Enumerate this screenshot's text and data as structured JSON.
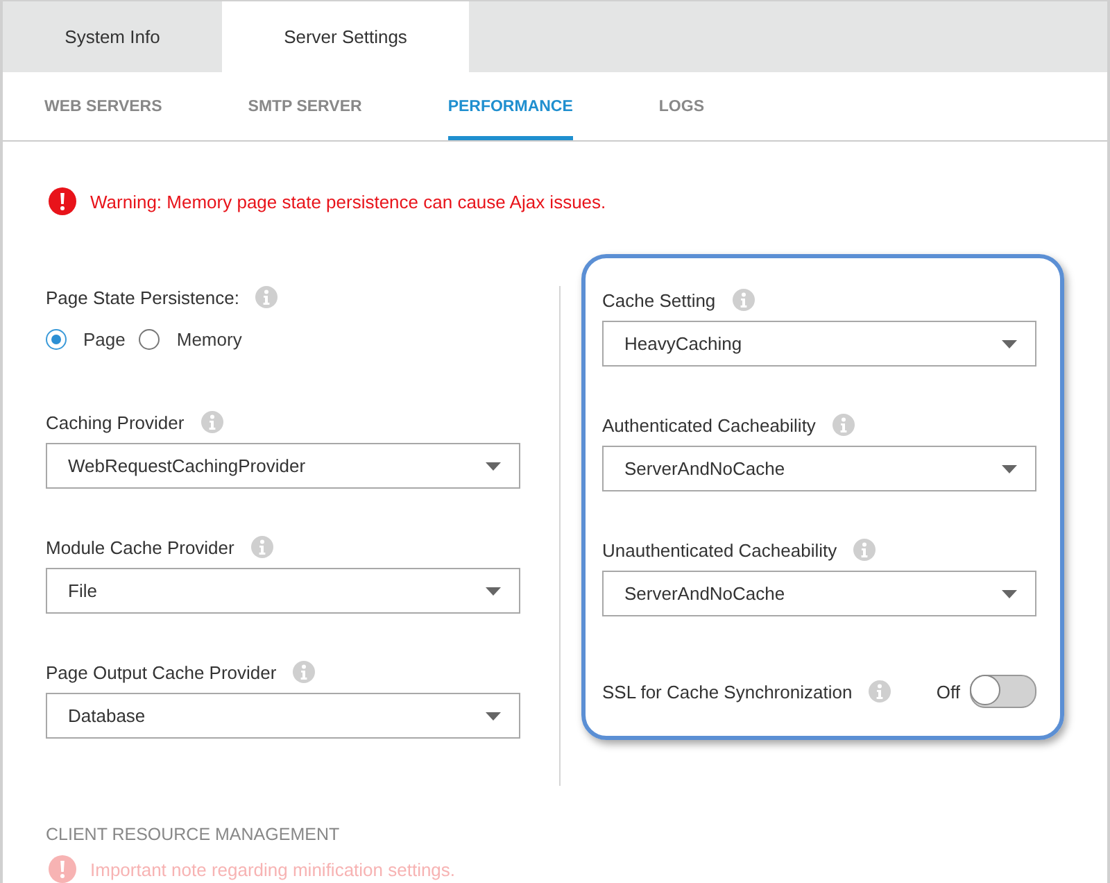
{
  "tabs": [
    {
      "label": "System Info",
      "selected": false
    },
    {
      "label": "Server Settings",
      "selected": true
    }
  ],
  "subtabs": [
    {
      "label": "WEB SERVERS",
      "selected": false
    },
    {
      "label": "SMTP SERVER",
      "selected": false
    },
    {
      "label": "PERFORMANCE",
      "selected": true
    },
    {
      "label": "LOGS",
      "selected": false
    }
  ],
  "warning": {
    "text": "Warning: Memory page state persistence can cause Ajax issues."
  },
  "left_fields": [
    {
      "kind": "radio",
      "label": "Page State Persistence:",
      "options": [
        {
          "label": "Page",
          "selected": true
        },
        {
          "label": "Memory",
          "selected": false
        }
      ]
    },
    {
      "kind": "select",
      "label": "Caching Provider",
      "value": "WebRequestCachingProvider"
    },
    {
      "kind": "select",
      "label": "Module Cache Provider",
      "value": "File"
    },
    {
      "kind": "select",
      "label": "Page Output Cache Provider",
      "value": "Database"
    }
  ],
  "right_panel": {
    "highlighted": true,
    "fields": [
      {
        "kind": "select",
        "label": "Cache Setting",
        "value": "HeavyCaching"
      },
      {
        "kind": "select",
        "label": "Authenticated Cacheability",
        "value": "ServerAndNoCache"
      },
      {
        "kind": "select",
        "label": "Unauthenticated Cacheability",
        "value": "ServerAndNoCache"
      },
      {
        "kind": "toggle",
        "label": "SSL for Cache Synchronization",
        "state_text": "Off",
        "on": false
      }
    ]
  },
  "section_heading": "CLIENT RESOURCE MANAGEMENT",
  "note": {
    "text": "Important note regarding minification settings."
  }
}
